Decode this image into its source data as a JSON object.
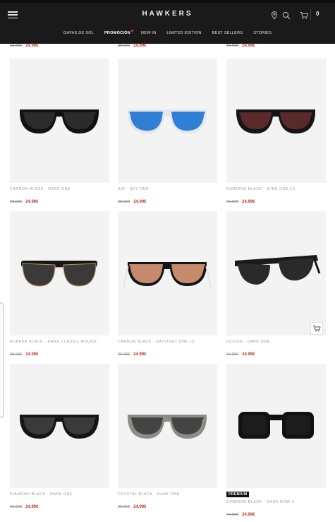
{
  "header": {
    "logo": "HAWKERS",
    "cart_count": "0",
    "icons": [
      "menu-icon",
      "location-pin-icon",
      "search-icon",
      "cart-icon"
    ]
  },
  "nav": {
    "items": [
      {
        "label": "GAFAS DE SOL",
        "active": false
      },
      {
        "label": "PROMOCIÓN",
        "active": true
      },
      {
        "label": "NEW IN",
        "active": false
      },
      {
        "label": "LIMITED EDITION",
        "active": false
      },
      {
        "label": "BEST SELLERS",
        "active": false
      },
      {
        "label": "STORIES",
        "active": false
      }
    ]
  },
  "top_partial_prices": [
    {
      "old": "39.99€",
      "new": "24.99€"
    },
    {
      "old": "39.99€",
      "new": "24.99€"
    },
    {
      "old": "39.99€",
      "new": "24.99€"
    }
  ],
  "products": [
    {
      "name": "CARBON BLACK · DARK ONE",
      "old": "29.99€",
      "new": "24.99€",
      "frame": "#111111",
      "lens": "#2b2b2b"
    },
    {
      "name": "AIR · SKY ONE",
      "old": "29.99€",
      "new": "24.99€",
      "frame": "#e4e6ea",
      "lens": "#2f7fd6"
    },
    {
      "name": "DIAMOND BLACK · WINE ONE LS",
      "old": "29.99€",
      "new": "24.99€",
      "frame": "#151515",
      "lens": "#5a2a2a"
    },
    {
      "name": "RUBBER BLACK · DARK CLASSIC ROUND...",
      "old": "29.99€",
      "new": "24.99€",
      "frame": "#151515",
      "lens": "#3a3a3a"
    },
    {
      "name": "CARBON BLACK · DAYLIGHT ONE LS",
      "old": "29.99€",
      "new": "24.99€",
      "frame": "#151515",
      "lens": "#c68a6d"
    },
    {
      "name": "FUSION · DARK ONE",
      "old": "34.99€",
      "new": "24.99€",
      "frame": "#1a1a1a",
      "lens": "#2a2a2a"
    },
    {
      "name": "DIAMOND BLACK · DARK ONE",
      "old": "29.99€",
      "new": "24.99€",
      "frame": "#151515",
      "lens": "#3a3a3a"
    },
    {
      "name": "CRYSTAL BLACK · DARK ONE",
      "old": "29.99€",
      "new": "24.99€",
      "frame": "#8d8d86",
      "lens": "#444444"
    },
    {
      "name": "DIAMOND BLACK · DARK ROW X",
      "old": "44.99€",
      "new": "24.99€",
      "frame": "#111111",
      "lens": "#1c1c1c",
      "badge": "PREMIUM"
    }
  ]
}
